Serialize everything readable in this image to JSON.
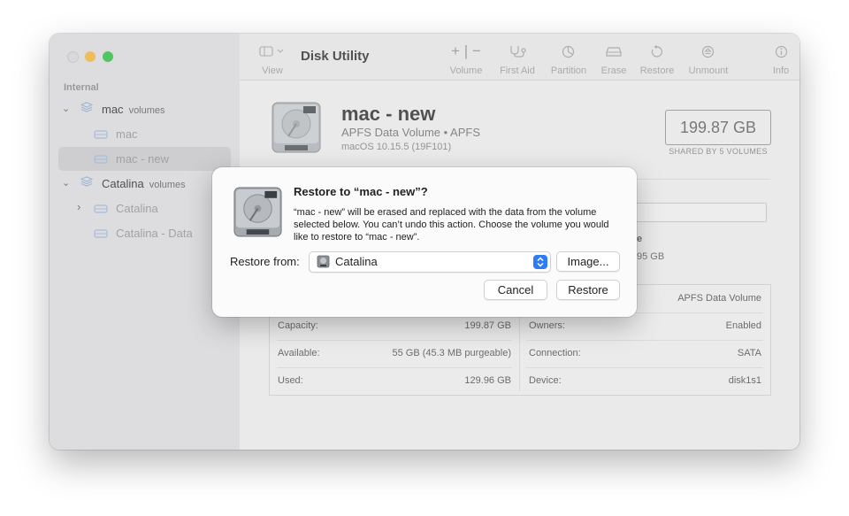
{
  "window": {
    "title": "Disk Utility"
  },
  "toolbar": {
    "view_label": "View",
    "volume_label": "Volume",
    "first_aid_label": "First Aid",
    "partition_label": "Partition",
    "erase_label": "Erase",
    "restore_label": "Restore",
    "unmount_label": "Unmount",
    "info_label": "Info"
  },
  "sidebar": {
    "section": "Internal",
    "items": [
      {
        "name": "mac",
        "sub": "volumes"
      },
      {
        "name": "mac"
      },
      {
        "name": "mac - new"
      },
      {
        "name": "Catalina",
        "sub": "volumes"
      },
      {
        "name": "Catalina"
      },
      {
        "name": "Catalina - Data"
      }
    ]
  },
  "volume": {
    "name": "mac - new",
    "type": "APFS Data Volume • APFS",
    "os": "macOS 10.15.5 (19F101)",
    "capacity_box": "199.87 GB",
    "shared": "SHARED BY 5 VOLUMES",
    "frag_e": "e",
    "frag_gb": "95 GB"
  },
  "info": {
    "type_value": "APFS Data Volume",
    "rows": [
      {
        "k1": "Capacity:",
        "v1": "199.87 GB",
        "k2": "Owners:",
        "v2": "Enabled"
      },
      {
        "k1": "Available:",
        "v1": "55 GB (45.3 MB purgeable)",
        "k2": "Connection:",
        "v2": "SATA"
      },
      {
        "k1": "Used:",
        "v1": "129.96 GB",
        "k2": "Device:",
        "v2": "disk1s1"
      }
    ]
  },
  "dialog": {
    "title": "Restore to “mac - new”?",
    "message": "“mac - new” will be erased and replaced with the data from the volume selected below. You can’t undo this action. Choose the volume you would like to restore to “mac - new”.",
    "restore_from_label": "Restore from:",
    "selected_volume": "Catalina",
    "image_button": "Image...",
    "cancel_button": "Cancel",
    "restore_button": "Restore"
  },
  "colors": {
    "accent": "#2f7bf6",
    "traffic_min": "#fdbc40",
    "traffic_max": "#33c748"
  }
}
